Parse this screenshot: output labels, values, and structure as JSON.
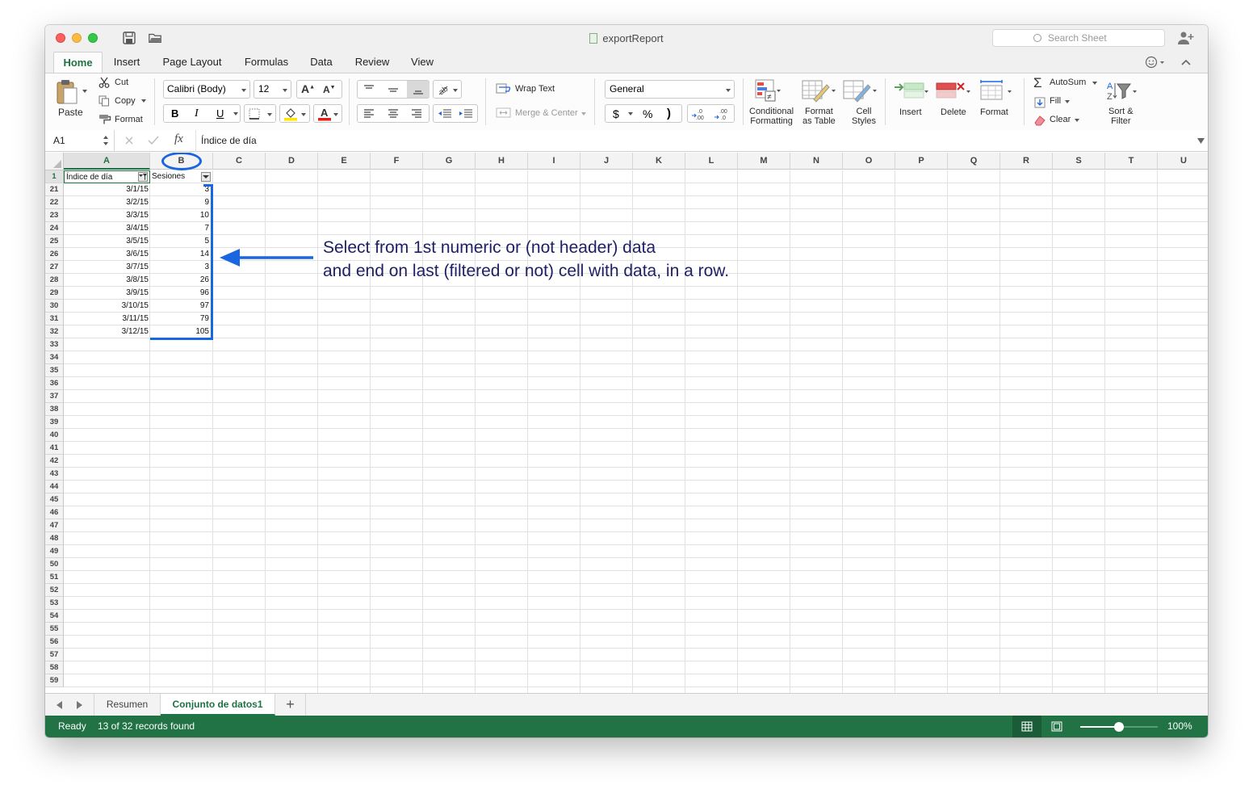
{
  "window": {
    "title": "exportReport",
    "search_placeholder": "Search Sheet"
  },
  "ribbon_tabs": [
    "Home",
    "Insert",
    "Page Layout",
    "Formulas",
    "Data",
    "Review",
    "View"
  ],
  "ribbon": {
    "paste": "Paste",
    "cut": "Cut",
    "copy": "Copy",
    "format_painter": "Format",
    "font_name": "Calibri (Body)",
    "font_size": "12",
    "bold": "B",
    "italic": "I",
    "underline": "U",
    "wrap_text": "Wrap Text",
    "merge_center": "Merge & Center",
    "number_format": "General",
    "currency": "$",
    "percent": "%",
    "comma": ")",
    "cond_format_1": "Conditional",
    "cond_format_2": "Formatting",
    "format_table_1": "Format",
    "format_table_2": "as Table",
    "cell_styles_1": "Cell",
    "cell_styles_2": "Styles",
    "insert": "Insert",
    "delete": "Delete",
    "format": "Format",
    "autosum": "AutoSum",
    "fill": "Fill",
    "clear": "Clear",
    "sort_filter_1": "Sort &",
    "sort_filter_2": "Filter"
  },
  "formula_bar": {
    "name_box": "A1",
    "fx": "fx",
    "content": "Índice de día"
  },
  "columns": [
    "A",
    "B",
    "C",
    "D",
    "E",
    "F",
    "G",
    "H",
    "I",
    "J",
    "K",
    "L",
    "M",
    "N",
    "O",
    "P",
    "Q",
    "R",
    "S",
    "T",
    "U"
  ],
  "table": {
    "header_row_number": "1",
    "headers": [
      "Índice de día",
      "Sesiones"
    ],
    "rows": [
      {
        "row": "21",
        "date": "3/1/15",
        "sessions": "3"
      },
      {
        "row": "22",
        "date": "3/2/15",
        "sessions": "9"
      },
      {
        "row": "23",
        "date": "3/3/15",
        "sessions": "10"
      },
      {
        "row": "24",
        "date": "3/4/15",
        "sessions": "7"
      },
      {
        "row": "25",
        "date": "3/5/15",
        "sessions": "5"
      },
      {
        "row": "26",
        "date": "3/6/15",
        "sessions": "14"
      },
      {
        "row": "27",
        "date": "3/7/15",
        "sessions": "3"
      },
      {
        "row": "28",
        "date": "3/8/15",
        "sessions": "26"
      },
      {
        "row": "29",
        "date": "3/9/15",
        "sessions": "96"
      },
      {
        "row": "30",
        "date": "3/10/15",
        "sessions": "97"
      },
      {
        "row": "31",
        "date": "3/11/15",
        "sessions": "79"
      },
      {
        "row": "32",
        "date": "3/12/15",
        "sessions": "105"
      }
    ]
  },
  "empty_rows": [
    "33",
    "34",
    "35",
    "36",
    "37",
    "38",
    "39",
    "40",
    "41",
    "42",
    "43",
    "44",
    "45",
    "46",
    "47",
    "48",
    "49",
    "50",
    "51",
    "52",
    "53",
    "54",
    "55",
    "56",
    "57",
    "58",
    "59"
  ],
  "annotation": {
    "line1": "Select from 1st numeric or (not header) data",
    "line2": "and end on last (filtered or not) cell with data, in a row.",
    "color": "#1a66e0"
  },
  "sheet_tabs": [
    "Resumen",
    "Conjunto de datos1"
  ],
  "add_sheet": "+",
  "status": {
    "ready": "Ready",
    "records": "13 of 32 records found",
    "zoom": "100%",
    "zoom_fraction": 0.5
  },
  "colors": {
    "excel_green": "#217346",
    "accent_text": "#1f7244"
  }
}
